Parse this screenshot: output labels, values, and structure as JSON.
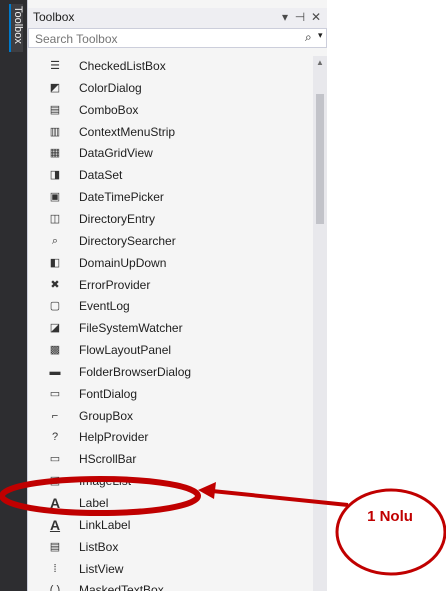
{
  "rail": {
    "label": "Toolbox"
  },
  "header": {
    "title": "Toolbox",
    "buttons": [
      "▾",
      "⊣",
      "✕"
    ]
  },
  "search": {
    "placeholder": "Search Toolbox"
  },
  "items": [
    {
      "label": "CheckedListBox",
      "icon": "checkedlistbox-icon",
      "glyph": "☰"
    },
    {
      "label": "ColorDialog",
      "icon": "colordialog-icon",
      "glyph": "◩"
    },
    {
      "label": "ComboBox",
      "icon": "combobox-icon",
      "glyph": "▤"
    },
    {
      "label": "ContextMenuStrip",
      "icon": "contextmenustrip-icon",
      "glyph": "▥"
    },
    {
      "label": "DataGridView",
      "icon": "datagridview-icon",
      "glyph": "▦"
    },
    {
      "label": "DataSet",
      "icon": "dataset-icon",
      "glyph": "◨"
    },
    {
      "label": "DateTimePicker",
      "icon": "datetimepicker-icon",
      "glyph": "▣"
    },
    {
      "label": "DirectoryEntry",
      "icon": "directoryentry-icon",
      "glyph": "◫"
    },
    {
      "label": "DirectorySearcher",
      "icon": "directorysearcher-icon",
      "glyph": "⌕"
    },
    {
      "label": "DomainUpDown",
      "icon": "domainupdown-icon",
      "glyph": "◧"
    },
    {
      "label": "ErrorProvider",
      "icon": "errorprovider-icon",
      "glyph": "✖"
    },
    {
      "label": "EventLog",
      "icon": "eventlog-icon",
      "glyph": "▢"
    },
    {
      "label": "FileSystemWatcher",
      "icon": "filesystemwatcher-icon",
      "glyph": "◪"
    },
    {
      "label": "FlowLayoutPanel",
      "icon": "flowlayoutpanel-icon",
      "glyph": "▩"
    },
    {
      "label": "FolderBrowserDialog",
      "icon": "folderbrowserdialog-icon",
      "glyph": "▬"
    },
    {
      "label": "FontDialog",
      "icon": "fontdialog-icon",
      "glyph": "▭"
    },
    {
      "label": "GroupBox",
      "icon": "groupbox-icon",
      "glyph": "⌐"
    },
    {
      "label": "HelpProvider",
      "icon": "helpprovider-icon",
      "glyph": "?"
    },
    {
      "label": "HScrollBar",
      "icon": "hscrollbar-icon",
      "glyph": "▭"
    },
    {
      "label": "ImageList",
      "icon": "imagelist-icon",
      "glyph": "▣"
    },
    {
      "label": "Label",
      "icon": "label-icon",
      "glyph": "A"
    },
    {
      "label": "LinkLabel",
      "icon": "linklabel-icon",
      "glyph": "A"
    },
    {
      "label": "ListBox",
      "icon": "listbox-icon",
      "glyph": "▤"
    },
    {
      "label": "ListView",
      "icon": "listview-icon",
      "glyph": "⁞"
    },
    {
      "label": "MaskedTextBox",
      "icon": "maskedtextbox-icon",
      "glyph": "(.)"
    }
  ],
  "annotation": {
    "text": "1 Nolu",
    "color": "#c00000"
  }
}
